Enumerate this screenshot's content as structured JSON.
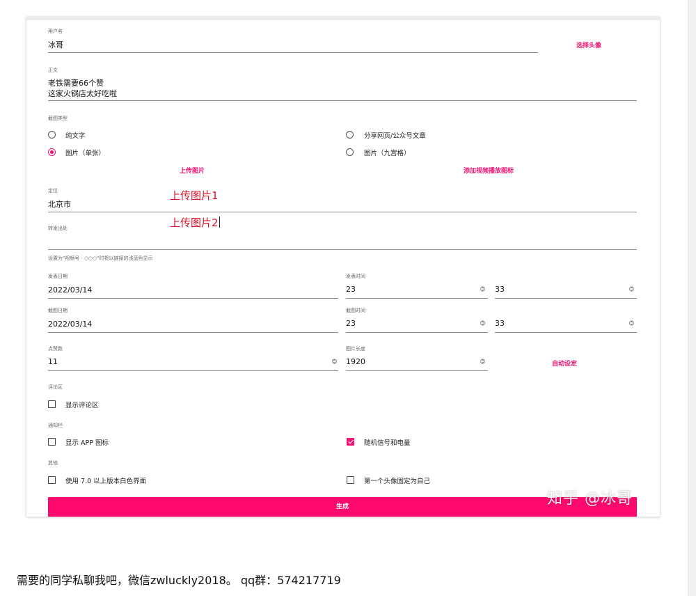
{
  "form": {
    "username": {
      "label": "用户名",
      "value": "冰哥"
    },
    "choose_avatar": "选择头像",
    "body": {
      "label": "正文",
      "line1": "老铁需要66个赞",
      "line2": "这家火锅店太好吃啦"
    },
    "screenshot_type": {
      "label": "截图类型",
      "options": [
        {
          "label": "纯文字",
          "selected": false
        },
        {
          "label": "分享网页/公众号文章",
          "selected": false
        },
        {
          "label": "图片（单张）",
          "selected": true
        },
        {
          "label": "图片（九宫格）",
          "selected": false
        }
      ]
    },
    "upload_image": "上传图片",
    "add_video_icon": "添加视频播放图标",
    "location": {
      "label": "定位",
      "value": "北京市"
    },
    "repost_source": {
      "label": "转发出处",
      "value": "",
      "hint": "设置为\"视频号 · ○○○\"时将以链接的浅蓝色显示"
    },
    "post_date": {
      "label": "发表日期",
      "value": "2022/03/14"
    },
    "post_time": {
      "label": "发表时间",
      "hour": "23",
      "minute": "33"
    },
    "capture_date": {
      "label": "截图日期",
      "value": "2022/03/14"
    },
    "capture_time": {
      "label": "截图时间",
      "hour": "23",
      "minute": "33"
    },
    "likes": {
      "label": "点赞数",
      "value": "11"
    },
    "image_length": {
      "label": "图片长度",
      "value": "1920"
    },
    "auto_set": "自动设定",
    "comments": {
      "label": "评论区",
      "show_comments": {
        "label": "显示评论区",
        "checked": false
      }
    },
    "notification_bar": {
      "label": "通知栏",
      "show_app_icon": {
        "label": "显示 APP 图标",
        "checked": false
      },
      "random_signal": {
        "label": "随机信号和电量",
        "checked": true
      }
    },
    "other": {
      "label": "其他",
      "white_ui": {
        "label": "使用 7.0 以上版本白色界面",
        "checked": false
      },
      "first_avatar_self": {
        "label": "第一个头像固定为自己",
        "checked": false
      }
    },
    "generate": "生成"
  },
  "overlay": {
    "upload1": "上传图片1",
    "upload2": "上传图片2"
  },
  "watermark": "知乎 @冰哥",
  "footer": "需要的同学私聊我吧，微信zwluckly2018。 qq群：574217719",
  "colors": {
    "accent": "#fe0a6e",
    "overlay_text": "#d8102a"
  },
  "icons": {
    "spinner": "spinner-arrows-icon",
    "radio": "radio-icon",
    "checkbox": "checkbox-icon"
  }
}
